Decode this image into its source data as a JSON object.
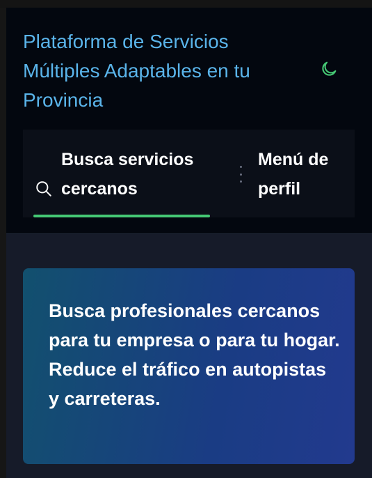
{
  "header": {
    "title": "Plataforma de Servicios Múltiples Adaptables en tu Provincia",
    "theme_toggle_icon": "moon-icon",
    "accent_color": "#45c874",
    "title_color": "#5ab4ea"
  },
  "nav": {
    "tabs": [
      {
        "label": "Busca servicios cercanos",
        "icon": "search-icon",
        "active": true
      },
      {
        "label": "Menú de perfil",
        "active": false
      }
    ],
    "more_icon": "vertical-dots-icon"
  },
  "hero": {
    "text": "Busca profesionales cercanos para tu empresa o para tu hogar.\nReduce el tráfico en autopistas y carreteras."
  }
}
